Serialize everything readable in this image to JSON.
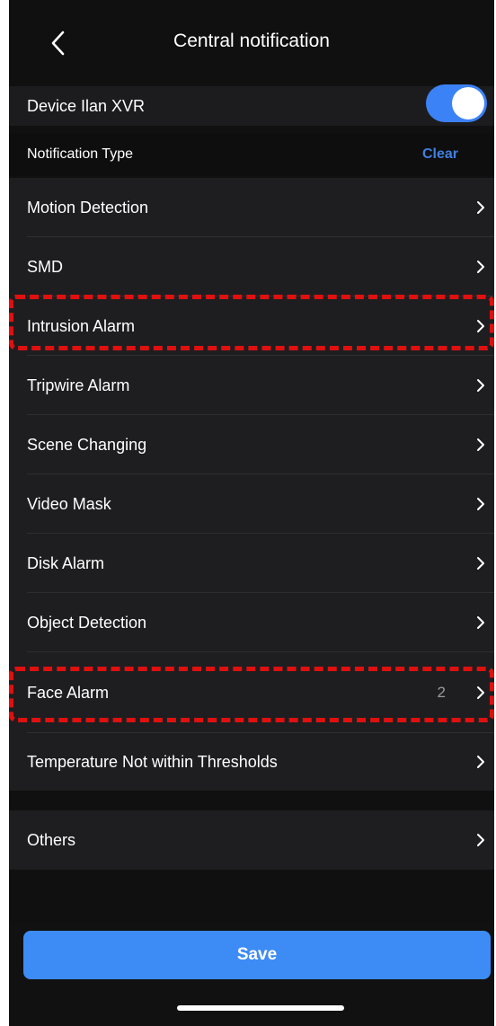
{
  "header": {
    "title": "Central notification"
  },
  "device": {
    "label": "Device Ilan XVR",
    "enabled": true
  },
  "section": {
    "label": "Notification Type",
    "clear_label": "Clear"
  },
  "items": [
    {
      "label": "Motion Detection"
    },
    {
      "label": "SMD"
    },
    {
      "label": "Intrusion Alarm"
    },
    {
      "label": "Tripwire Alarm"
    },
    {
      "label": "Scene Changing"
    },
    {
      "label": "Video Mask"
    },
    {
      "label": "Disk Alarm"
    },
    {
      "label": "Object Detection"
    },
    {
      "label": "Face Alarm",
      "count": "2"
    },
    {
      "label": "Temperature Not within Thresholds"
    }
  ],
  "others": {
    "label": "Others"
  },
  "footer": {
    "save_label": "Save"
  },
  "colors": {
    "accent": "#3c82f7",
    "highlight": "#e0100f",
    "background": "#101010",
    "row": "#1e1e20"
  }
}
